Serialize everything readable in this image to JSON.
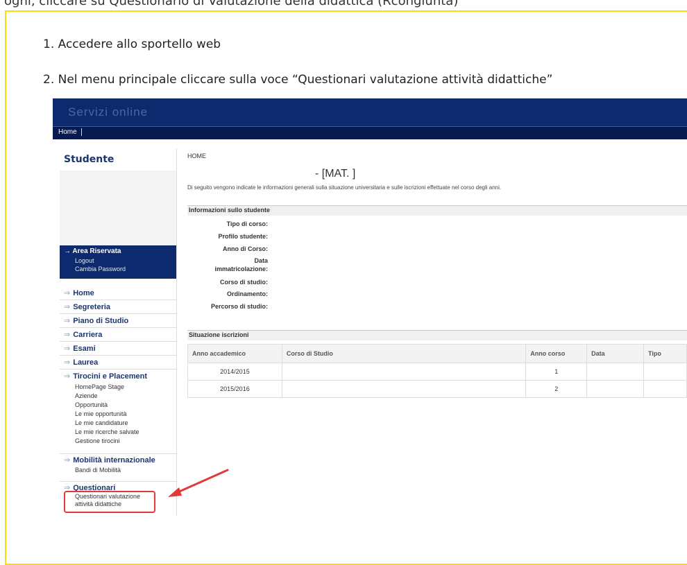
{
  "document": {
    "steps": [
      "1. Accedere allo sportello web",
      "2. Nel menu principale cliccare sulla voce “Questionari valutazione attività didattiche”"
    ]
  },
  "portal": {
    "banner_title": "Servizi online",
    "menubar_home": "Home",
    "sidebar": {
      "title": "Studente",
      "area_riservata": {
        "label": "Area Riservata",
        "items": [
          "Logout",
          "Cambia Password"
        ]
      },
      "nav": [
        {
          "label": "Home"
        },
        {
          "label": "Segreteria"
        },
        {
          "label": "Piano di Studio"
        },
        {
          "label": "Carriera"
        },
        {
          "label": "Esami"
        },
        {
          "label": "Laurea"
        },
        {
          "label": "Tirocini e Placement",
          "items": [
            "HomePage Stage",
            "Aziende",
            "Opportunità",
            "Le mie opportunità",
            "Le mie candidature",
            "Le mie ricerche salvate",
            "Gestione tirocini"
          ]
        },
        {
          "label": "Mobilità internazionale",
          "items": [
            "Bandi di Mobilità"
          ]
        },
        {
          "label": "Questionari",
          "items": [
            "Questionari valutazione",
            "attività didattiche"
          ]
        }
      ]
    },
    "main": {
      "breadcrumb": "HOME",
      "student_header": "- [MAT.            ]",
      "intro": "Di seguito vengono indicate le informazioni generali sulla situazione universitaria e sulle iscrizioni effettuate nel corso degli anni.",
      "info_section_title": "Informazioni sullo studente",
      "info_labels": [
        "Tipo di corso:",
        "Profilo studente:",
        "Anno di Corso:",
        "Data",
        "immatricolazione:",
        "Corso di studio:",
        "Ordinamento:",
        "Percorso di studio:"
      ],
      "enrollment_section_title": "Situazione iscrizioni",
      "table": {
        "headers": [
          "Anno accademico",
          "Corso di Studio",
          "Anno corso",
          "Data",
          "Tipo"
        ],
        "rows": [
          [
            "2014/2015",
            "",
            "1",
            "",
            ""
          ],
          [
            "2015/2016",
            "",
            "2",
            "",
            ""
          ]
        ]
      }
    }
  },
  "colors": {
    "banner": "#0d2a6e",
    "document_border": "#ffdd00",
    "highlight": "#e23a3a"
  }
}
